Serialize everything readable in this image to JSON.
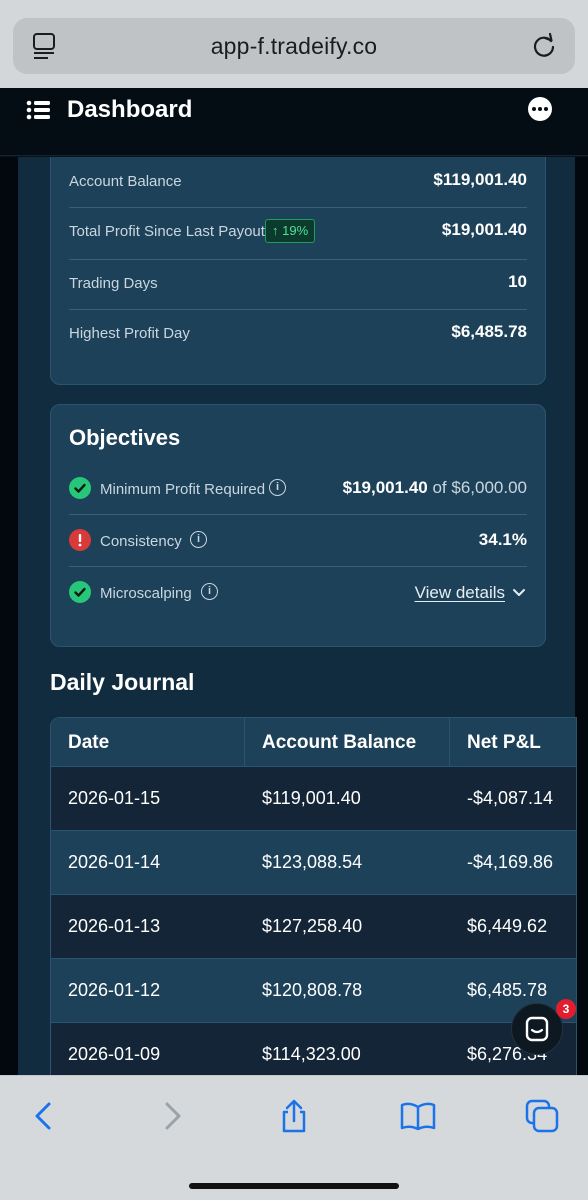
{
  "browser": {
    "url": "app-f.tradeify.co",
    "reader_icon": "reader-icon",
    "reload_icon": "reload-icon",
    "toolbar_icons": [
      "back-icon",
      "forward-icon",
      "share-icon",
      "bookmarks-icon",
      "tabs-icon"
    ]
  },
  "header": {
    "title": "Dashboard",
    "menu_icon": "menu-icon",
    "more_icon": "more-icon"
  },
  "stats": {
    "rows": [
      {
        "label": "Account Balance",
        "value": "$119,001.40"
      },
      {
        "label": "Total Profit Since Last Payout",
        "badge": "↑ 19%",
        "value": "$19,001.40"
      },
      {
        "label": "Trading Days",
        "value": "10"
      },
      {
        "label": "Highest Profit Day",
        "value": "$6,485.78"
      }
    ]
  },
  "objectives": {
    "title": "Objectives",
    "rows": [
      {
        "status": "passed",
        "label": "Minimum Profit Required",
        "value": "$19,001.40",
        "of_text": "of $6,000.00"
      },
      {
        "status": "failed",
        "label": "Consistency",
        "value": "34.1%"
      },
      {
        "status": "passed",
        "label": "Microscalping",
        "link": "View details"
      }
    ]
  },
  "journal": {
    "title": "Daily Journal",
    "columns": [
      "Date",
      "Account Balance",
      "Net P&L"
    ],
    "rows": [
      {
        "date": "2026-01-15",
        "balance": "$119,001.40",
        "pnl": "-$4,087.14"
      },
      {
        "date": "2026-01-14",
        "balance": "$123,088.54",
        "pnl": "-$4,169.86"
      },
      {
        "date": "2026-01-13",
        "balance": "$127,258.40",
        "pnl": "$6,449.62"
      },
      {
        "date": "2026-01-12",
        "balance": "$120,808.78",
        "pnl": "$6,485.78"
      },
      {
        "date": "2026-01-09",
        "balance": "$114,323.00",
        "pnl": "$6,276.34"
      }
    ]
  },
  "chat": {
    "badge_count": "3"
  },
  "colors": {
    "accent": "#27c77a",
    "danger": "#d83a3a",
    "card": "#1d4159",
    "link_blue": "#1a73e8"
  }
}
